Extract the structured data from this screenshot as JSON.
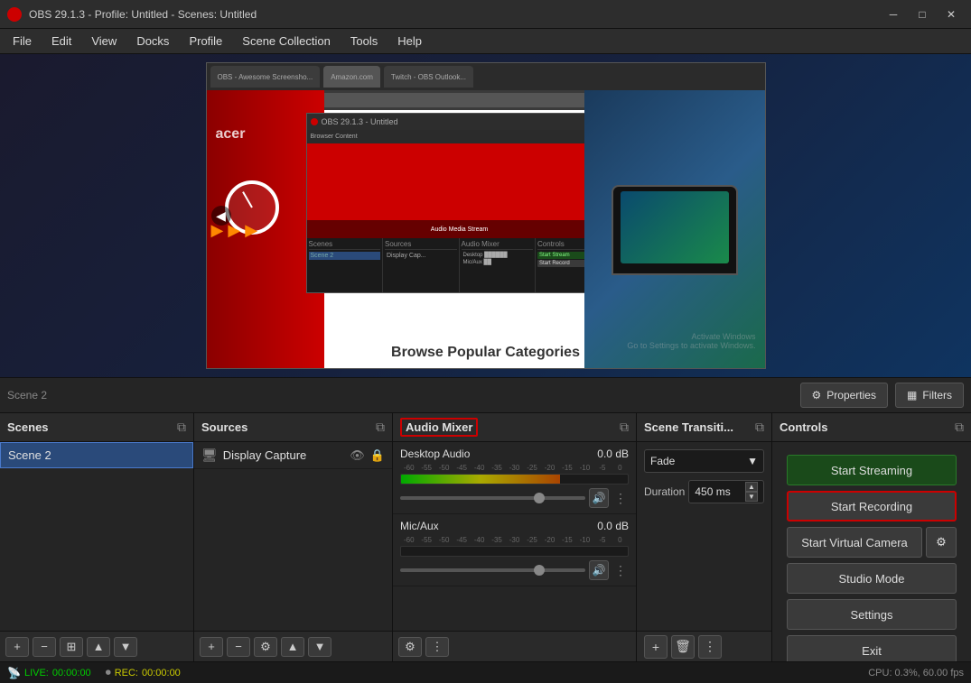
{
  "window": {
    "title": "OBS 29.1.3 - Profile: Untitled - Scenes: Untitled",
    "minimize": "─",
    "maximize": "□",
    "close": "✕"
  },
  "menu": {
    "items": [
      "File",
      "Edit",
      "View",
      "Docks",
      "Profile",
      "Scene Collection",
      "Tools",
      "Help"
    ]
  },
  "dock": {
    "properties_label": "Properties",
    "filters_label": "Filters"
  },
  "panels": {
    "scenes": {
      "title": "Scenes",
      "items": [
        {
          "label": "Scene 2",
          "selected": true
        }
      ]
    },
    "sources": {
      "title": "Sources",
      "items": [
        {
          "label": "Display Capture",
          "icon": "🖥"
        }
      ]
    },
    "audio_mixer": {
      "title": "Audio Mixer",
      "channels": [
        {
          "name": "Desktop Audio",
          "db": "0.0 dB",
          "ticks": [
            "-60",
            "-55",
            "-50",
            "-45",
            "-40",
            "-35",
            "-30",
            "-25",
            "-20",
            "-15",
            "-10",
            "-5",
            "0"
          ],
          "fill_width": "70%"
        },
        {
          "name": "Mic/Aux",
          "db": "0.0 dB",
          "ticks": [
            "-60",
            "-55",
            "-50",
            "-45",
            "-40",
            "-35",
            "-30",
            "-25",
            "-20",
            "-15",
            "-10",
            "-5",
            "0"
          ],
          "fill_width": "0%"
        }
      ]
    },
    "transitions": {
      "title": "Scene Transiti...",
      "type": "Fade",
      "duration_label": "Duration",
      "duration_value": "450 ms"
    },
    "controls": {
      "title": "Controls",
      "start_streaming": "Start Streaming",
      "start_recording": "Start Recording",
      "start_virtual_camera": "Start Virtual Camera",
      "studio_mode": "Studio Mode",
      "settings": "Settings",
      "exit": "Exit"
    }
  },
  "status_bar": {
    "live_icon": "📡",
    "live_label": "LIVE:",
    "live_time": "00:00:00",
    "rec_icon": "⏺",
    "rec_label": "REC:",
    "rec_time": "00:00:00",
    "cpu_label": "CPU: 0.3%, 60.00 fps"
  },
  "preview": {
    "browse_text": "Browse Popular Categories",
    "activate_text": "Activate Windows\nGo to Settings to activate Windows."
  }
}
